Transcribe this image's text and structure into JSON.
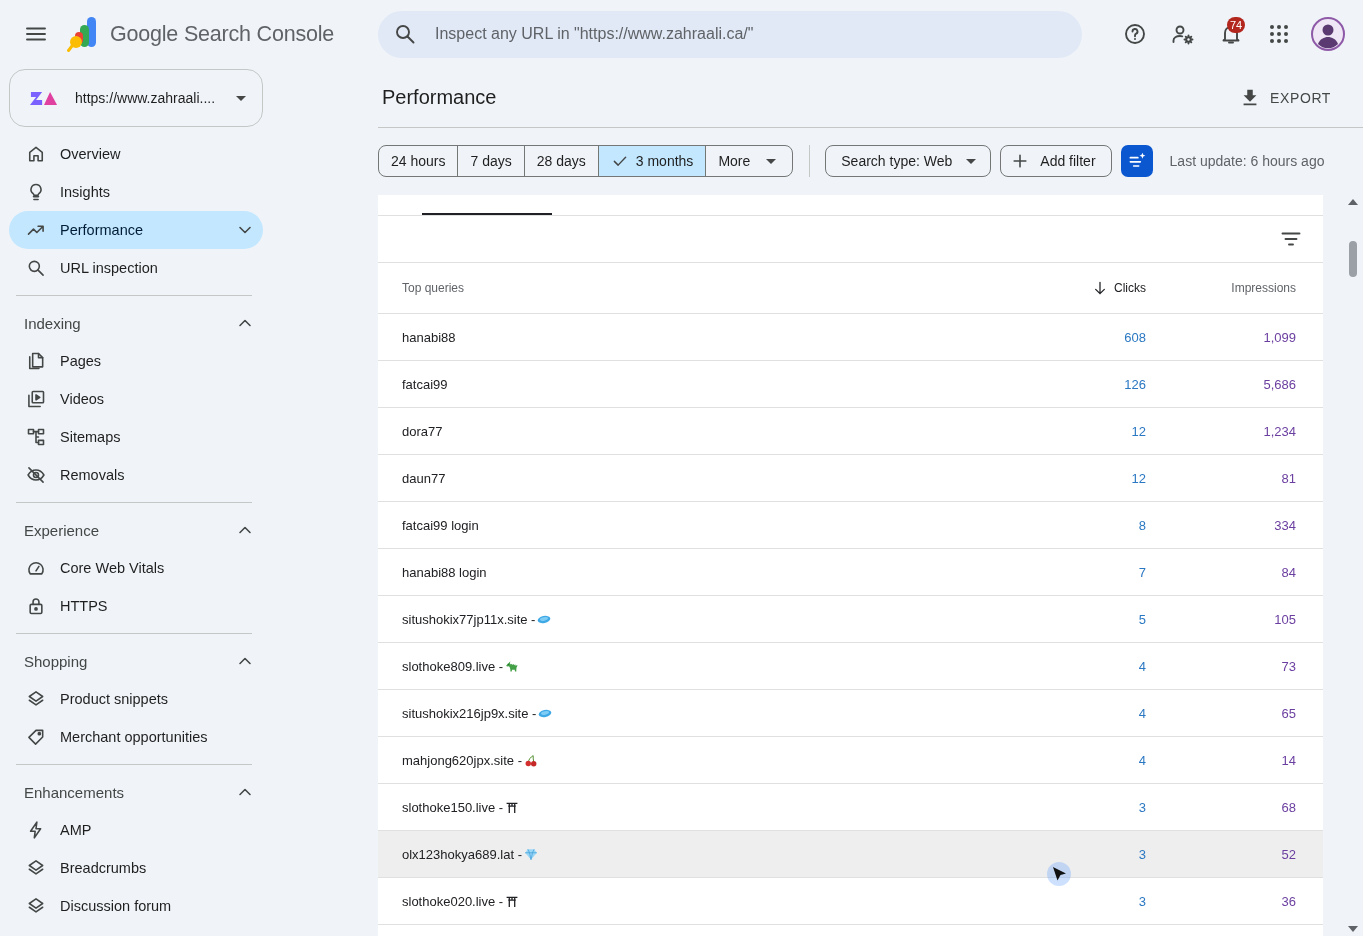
{
  "header": {
    "app_name": "Google Search Console",
    "search": {
      "placeholder": "Inspect any URL in \"https://www.zahraali.ca/\""
    },
    "notifications": {
      "badge": "74"
    }
  },
  "property": {
    "label": "https://www.zahraali...."
  },
  "sidebar": {
    "items": [
      {
        "label": "Overview",
        "kind": "home",
        "selected": false
      },
      {
        "label": "Insights",
        "kind": "bulb",
        "selected": false
      },
      {
        "label": "Performance",
        "kind": "trend",
        "selected": true,
        "expanded": false
      },
      {
        "label": "URL inspection",
        "kind": "search",
        "selected": false
      }
    ],
    "sections": [
      {
        "title": "Indexing",
        "expanded": true,
        "items": [
          {
            "label": "Pages",
            "kind": "pages",
            "selected": false
          },
          {
            "label": "Videos",
            "kind": "video",
            "selected": false
          },
          {
            "label": "Sitemaps",
            "kind": "sitemap",
            "selected": false
          },
          {
            "label": "Removals",
            "kind": "hidden",
            "selected": false
          }
        ]
      },
      {
        "title": "Experience",
        "expanded": true,
        "items": [
          {
            "label": "Core Web Vitals",
            "kind": "gauge",
            "selected": false
          },
          {
            "label": "HTTPS",
            "kind": "lock",
            "selected": false
          }
        ]
      },
      {
        "title": "Shopping",
        "expanded": true,
        "items": [
          {
            "label": "Product snippets",
            "kind": "layers",
            "selected": false
          },
          {
            "label": "Merchant opportunities",
            "kind": "tag",
            "selected": false
          }
        ]
      },
      {
        "title": "Enhancements",
        "expanded": true,
        "items": [
          {
            "label": "AMP",
            "kind": "bolt",
            "selected": false
          },
          {
            "label": "Breadcrumbs",
            "kind": "layers",
            "selected": false
          },
          {
            "label": "Discussion forum",
            "kind": "layers",
            "selected": false
          }
        ]
      }
    ]
  },
  "page": {
    "title": "Performance",
    "export": "EXPORT"
  },
  "filters": {
    "date_ranges": [
      {
        "label": "24 hours",
        "selected": false
      },
      {
        "label": "7 days",
        "selected": false
      },
      {
        "label": "28 days",
        "selected": false
      },
      {
        "label": "3 months",
        "selected": true
      }
    ],
    "more": "More",
    "search_type": "Search type: Web",
    "add_filter": "Add filter",
    "last_update": "Last update: 6 hours ago"
  },
  "table": {
    "columns": [
      {
        "label": "Top queries",
        "sorted": false
      },
      {
        "label": "Clicks",
        "sorted": true
      },
      {
        "label": "Impressions",
        "sorted": false
      }
    ],
    "rows": [
      {
        "query": "hanabi88",
        "kind": "plain",
        "clicks": "608",
        "impressions": "1,099",
        "hovered": false
      },
      {
        "query": "fatcai99",
        "kind": "plain",
        "clicks": "126",
        "impressions": "5,686",
        "hovered": false
      },
      {
        "query": "dora77",
        "kind": "plain",
        "clicks": "12",
        "impressions": "1,234",
        "hovered": false
      },
      {
        "query": "daun77",
        "kind": "plain",
        "clicks": "12",
        "impressions": "81",
        "hovered": false
      },
      {
        "query": "fatcai99 login",
        "kind": "plain",
        "clicks": "8",
        "impressions": "334",
        "hovered": false
      },
      {
        "query": "hanabi88 login",
        "kind": "plain",
        "clicks": "7",
        "impressions": "84",
        "hovered": false
      },
      {
        "query": "situshokix77jp11x.site -",
        "kind": "disc",
        "clicks": "5",
        "impressions": "105",
        "hovered": false
      },
      {
        "query": "slothoke809.live -",
        "kind": "dragon",
        "clicks": "4",
        "impressions": "73",
        "hovered": false
      },
      {
        "query": "situshokix216jp9x.site -",
        "kind": "disc",
        "clicks": "4",
        "impressions": "65",
        "hovered": false
      },
      {
        "query": "mahjong620jpx.site -",
        "kind": "cherries",
        "clicks": "4",
        "impressions": "14",
        "hovered": false
      },
      {
        "query": "slothoke150.live -",
        "kind": "shrine",
        "clicks": "3",
        "impressions": "68",
        "hovered": false
      },
      {
        "query": "olx123hokya689.lat -",
        "kind": "gem",
        "clicks": "3",
        "impressions": "52",
        "hovered": true
      },
      {
        "query": "slothoke020.live -",
        "kind": "shrine",
        "clicks": "3",
        "impressions": "36",
        "hovered": false
      }
    ]
  }
}
